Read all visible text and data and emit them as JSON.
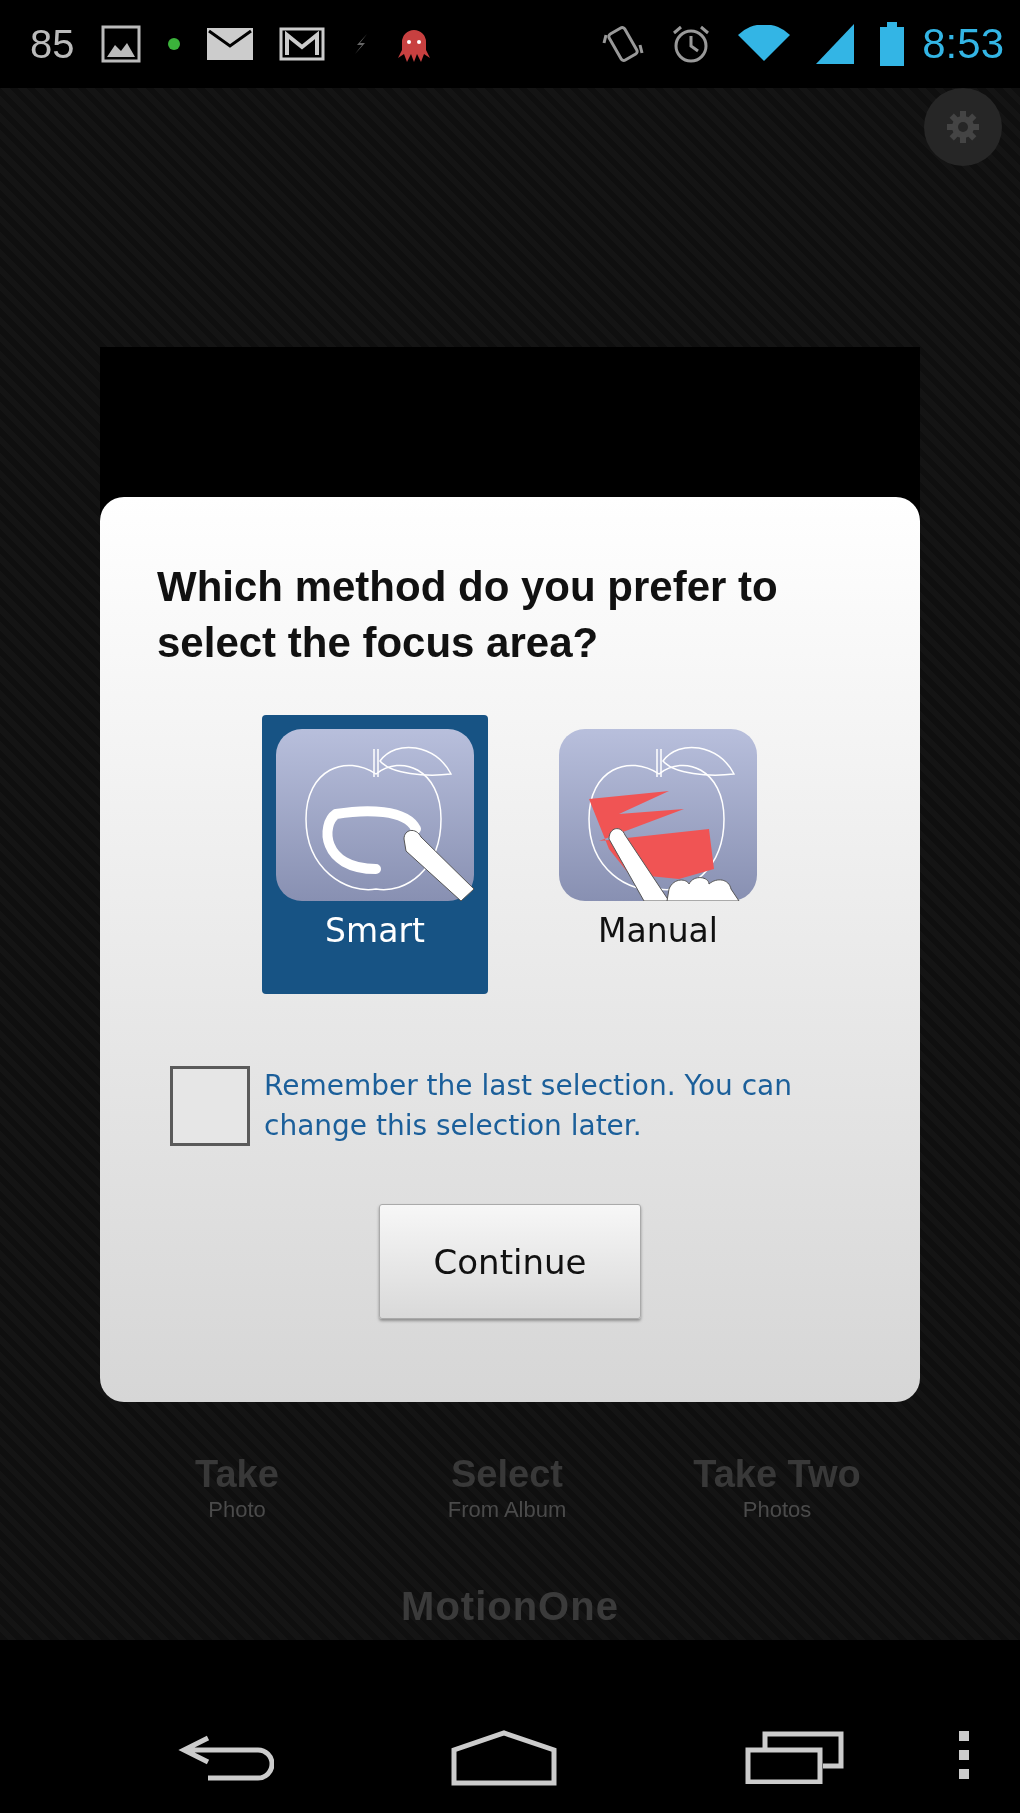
{
  "status_bar": {
    "notification_count": "85",
    "time": "8:53"
  },
  "background": {
    "actions": [
      {
        "title": "Take",
        "subtitle": "Photo"
      },
      {
        "title": "Select",
        "subtitle": "From Album"
      },
      {
        "title": "Take Two",
        "subtitle": "Photos"
      }
    ],
    "logo": "MotionOne"
  },
  "dialog": {
    "title": "Which method do you prefer to select the focus area?",
    "options": [
      {
        "kind": "smart",
        "label": "Smart",
        "selected": true
      },
      {
        "kind": "manual",
        "label": "Manual",
        "selected": false
      }
    ],
    "remember": {
      "label": "Remember the last selection. You can change this selection later.",
      "checked": false
    },
    "continue_button": "Continue"
  }
}
